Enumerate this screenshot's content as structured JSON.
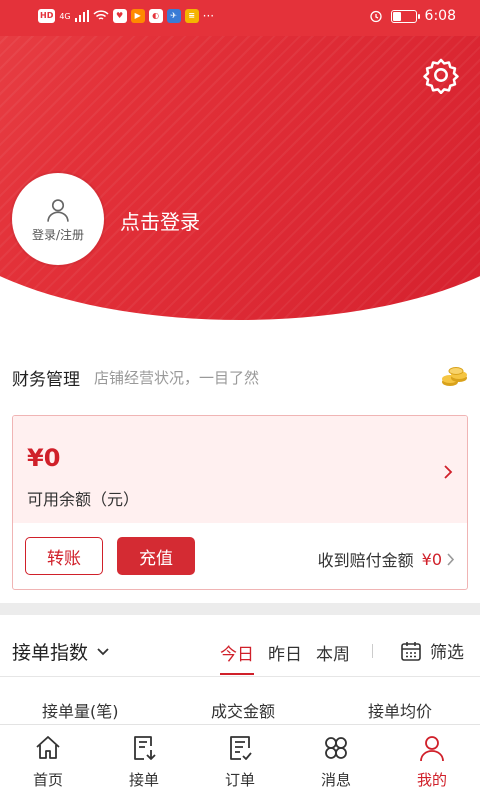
{
  "status_bar": {
    "network_label": "HD",
    "signal_label": "4G",
    "time": "6:08",
    "dots": "···"
  },
  "header": {
    "avatar_label": "登录/注册",
    "login_text": "点击登录"
  },
  "finance": {
    "title": "财务管理",
    "subtitle": "店铺经营状况，一目了然",
    "balance": "¥0",
    "balance_label": "可用余额（元）",
    "transfer_button": "转账",
    "recharge_button": "充值",
    "compensation_label": "收到赔付金额",
    "compensation_value": "¥0"
  },
  "index": {
    "title": "接单指数",
    "tabs": [
      {
        "label": "今日",
        "active": true
      },
      {
        "label": "昨日",
        "active": false
      },
      {
        "label": "本周",
        "active": false
      }
    ],
    "filter_label": "筛选",
    "stats": [
      "接单量(笔)",
      "成交金额",
      "接单均价"
    ]
  },
  "nav": {
    "items": [
      {
        "label": "首页",
        "icon": "home-icon",
        "active": false
      },
      {
        "label": "接单",
        "icon": "receive-order-icon",
        "active": false
      },
      {
        "label": "订单",
        "icon": "order-list-icon",
        "active": false
      },
      {
        "label": "消息",
        "icon": "message-icon",
        "active": false
      },
      {
        "label": "我的",
        "icon": "profile-icon",
        "active": true
      }
    ]
  },
  "colors": {
    "brand_red": "#d0202a",
    "header_gradient_start": "#f05a5a",
    "header_gradient_end": "#d41f2d",
    "card_bg": "#fff0f0"
  }
}
